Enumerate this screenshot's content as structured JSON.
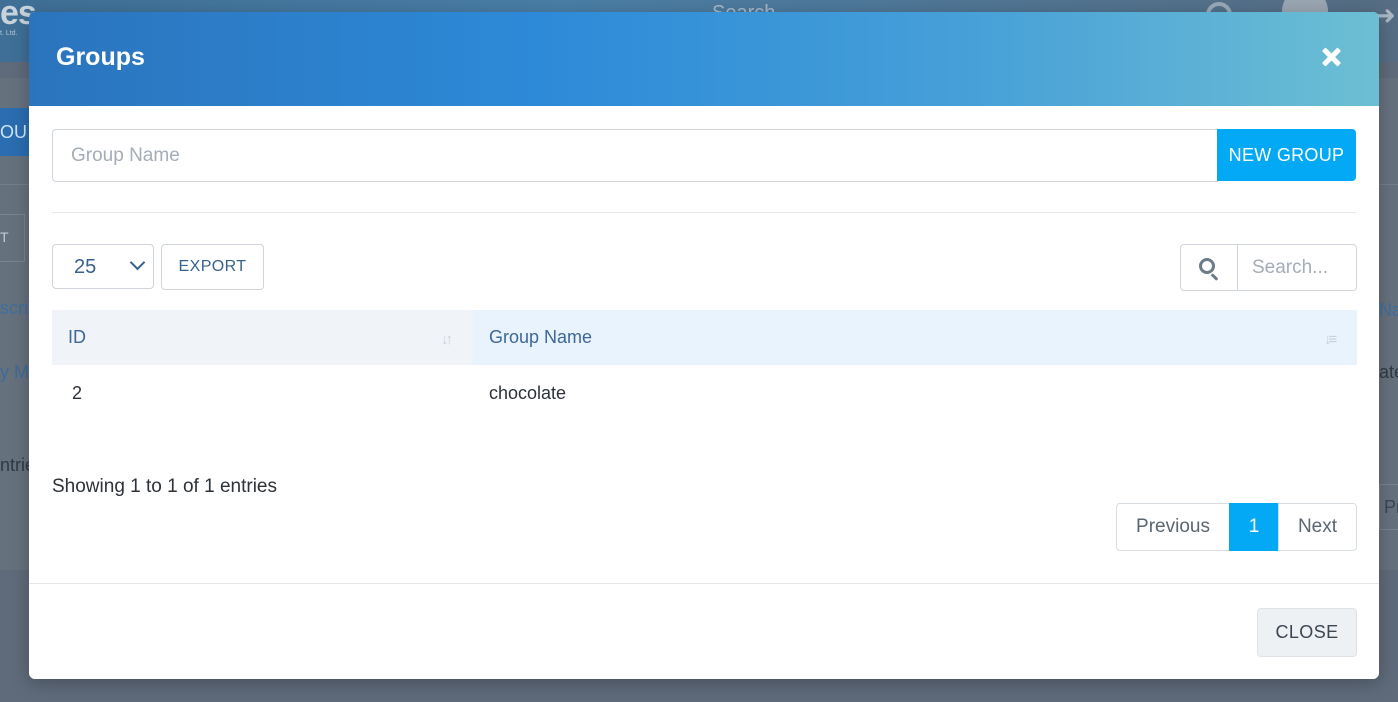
{
  "background": {
    "logo_text": "es",
    "logo_subtext": "t. Ltd.",
    "search_label": "Search",
    "tab_label": "OU",
    "button_left": "T",
    "table_header_left": "scrip",
    "table_cell_left": "y M",
    "entries_left": "ntrie",
    "table_header_right": "Na",
    "table_cell_right": "ate",
    "pager_right": "Pre"
  },
  "modal": {
    "title": "Groups",
    "group_name_placeholder": "Group Name",
    "new_group_label": "NEW GROUP",
    "page_size": "25",
    "export_label": "EXPORT",
    "search_placeholder": "Search...",
    "columns": [
      "ID",
      "Group Name"
    ],
    "rows": [
      {
        "id": "2",
        "group_name": "chocolate"
      }
    ],
    "info_text": "Showing 1 to 1 of 1 entries",
    "pagination": {
      "previous": "Previous",
      "current": "1",
      "next": "Next"
    },
    "close_label": "CLOSE"
  },
  "colors": {
    "primary": "#03a9f4",
    "header_gradient_start": "#2b74bd",
    "header_gradient_end": "#6cbfd3",
    "link_text": "#3d6898"
  }
}
